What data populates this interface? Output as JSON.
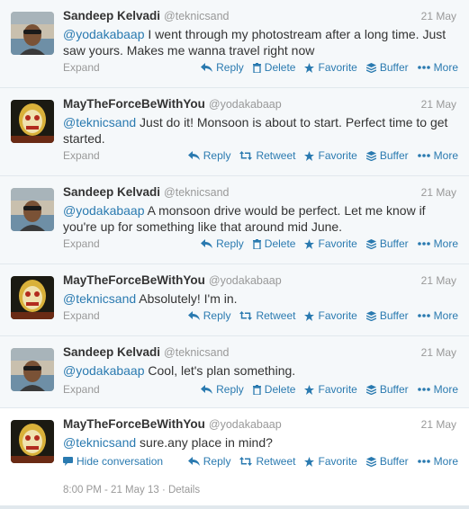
{
  "actions": {
    "reply": "Reply",
    "delete": "Delete",
    "retweet": "Retweet",
    "favorite": "Favorite",
    "buffer": "Buffer",
    "more": "More",
    "expand": "Expand",
    "hide": "Hide conversation"
  },
  "tweets": [
    {
      "fullname": "Sandeep Kelvadi",
      "username": "@teknicsand",
      "time": "21 May",
      "mention": "@yodakabaap",
      "text": " I went through my photostream after a long time. Just saw yours. Makes me wanna travel right now"
    },
    {
      "fullname": "MayTheForceBeWithYou",
      "username": "@yodakabaap",
      "time": "21 May",
      "mention": "@teknicsand",
      "text": " Just do it! Monsoon is about to start. Perfect time to get started."
    },
    {
      "fullname": "Sandeep Kelvadi",
      "username": "@teknicsand",
      "time": "21 May",
      "mention": "@yodakabaap",
      "text": " A monsoon drive would be perfect. Let me know if you're up for something like that around mid June."
    },
    {
      "fullname": "MayTheForceBeWithYou",
      "username": "@yodakabaap",
      "time": "21 May",
      "mention": "@teknicsand",
      "text": " Absolutely! I'm in."
    },
    {
      "fullname": "Sandeep Kelvadi",
      "username": "@teknicsand",
      "time": "21 May",
      "mention": "@yodakabaap",
      "text": " Cool, let's plan something."
    },
    {
      "fullname": "MayTheForceBeWithYou",
      "username": "@yodakabaap",
      "time": "21 May",
      "mention": "@teknicsand",
      "text": " sure.any place in mind?",
      "details": "8:00 PM - 21 May 13 · Details"
    }
  ],
  "colors": {
    "link": "#2a7ab0",
    "muted": "#999999",
    "background_collapsed": "#f5f8fa",
    "border": "#e1e8ed"
  }
}
